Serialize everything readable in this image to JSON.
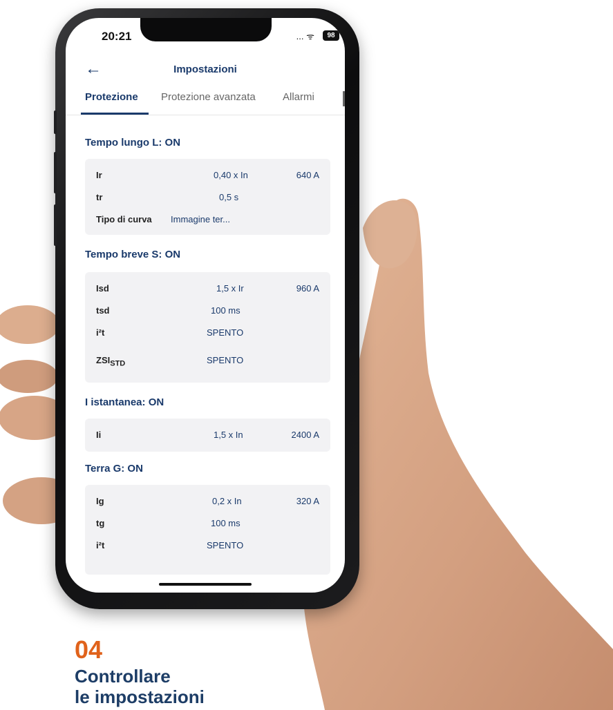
{
  "status": {
    "time": "20:21",
    "signal": "... ᯤ",
    "battery": "98"
  },
  "appbar": {
    "back_icon": "←",
    "title": "Impostazioni"
  },
  "tabs": [
    {
      "label": "Protezione",
      "active": true
    },
    {
      "label": "Protezione avanzata",
      "active": false
    },
    {
      "label": "Allarmi",
      "active": false
    }
  ],
  "sections": {
    "long": {
      "title": "Tempo lungo L: ON",
      "rows": [
        {
          "label": "Ir",
          "value": "0,40 x In",
          "amp": "640 A"
        },
        {
          "label": "tr",
          "value": "0,5 s",
          "amp": ""
        },
        {
          "label": "Tipo di curva",
          "value": "Immagine ter...",
          "amp": ""
        }
      ]
    },
    "short": {
      "title": "Tempo breve S: ON",
      "rows": [
        {
          "label": "Isd",
          "value": "1,5 x Ir",
          "amp": "960 A"
        },
        {
          "label": "tsd",
          "value": "100 ms",
          "amp": ""
        },
        {
          "label": "i²t",
          "value": "SPENTO",
          "amp": ""
        },
        {
          "label": "ZSI",
          "label_sub": "STD",
          "value": "SPENTO",
          "amp": ""
        }
      ]
    },
    "inst": {
      "title": "I istantanea: ON",
      "rows": [
        {
          "label": "Ii",
          "value": "1,5 x In",
          "amp": "2400 A"
        }
      ]
    },
    "ground": {
      "title": "Terra G: ON",
      "rows": [
        {
          "label": "Ig",
          "value": "0,2 x In",
          "amp": "320 A"
        },
        {
          "label": "tg",
          "value": "100 ms",
          "amp": ""
        },
        {
          "label": "i²t",
          "value": "SPENTO",
          "amp": ""
        }
      ]
    }
  },
  "caption": {
    "number": "04",
    "line1": "Controllare",
    "line2": "le impostazioni"
  },
  "colors": {
    "accent": "#1a3a6b",
    "caption_number": "#e0621b",
    "caption_text": "#1d3d66"
  }
}
